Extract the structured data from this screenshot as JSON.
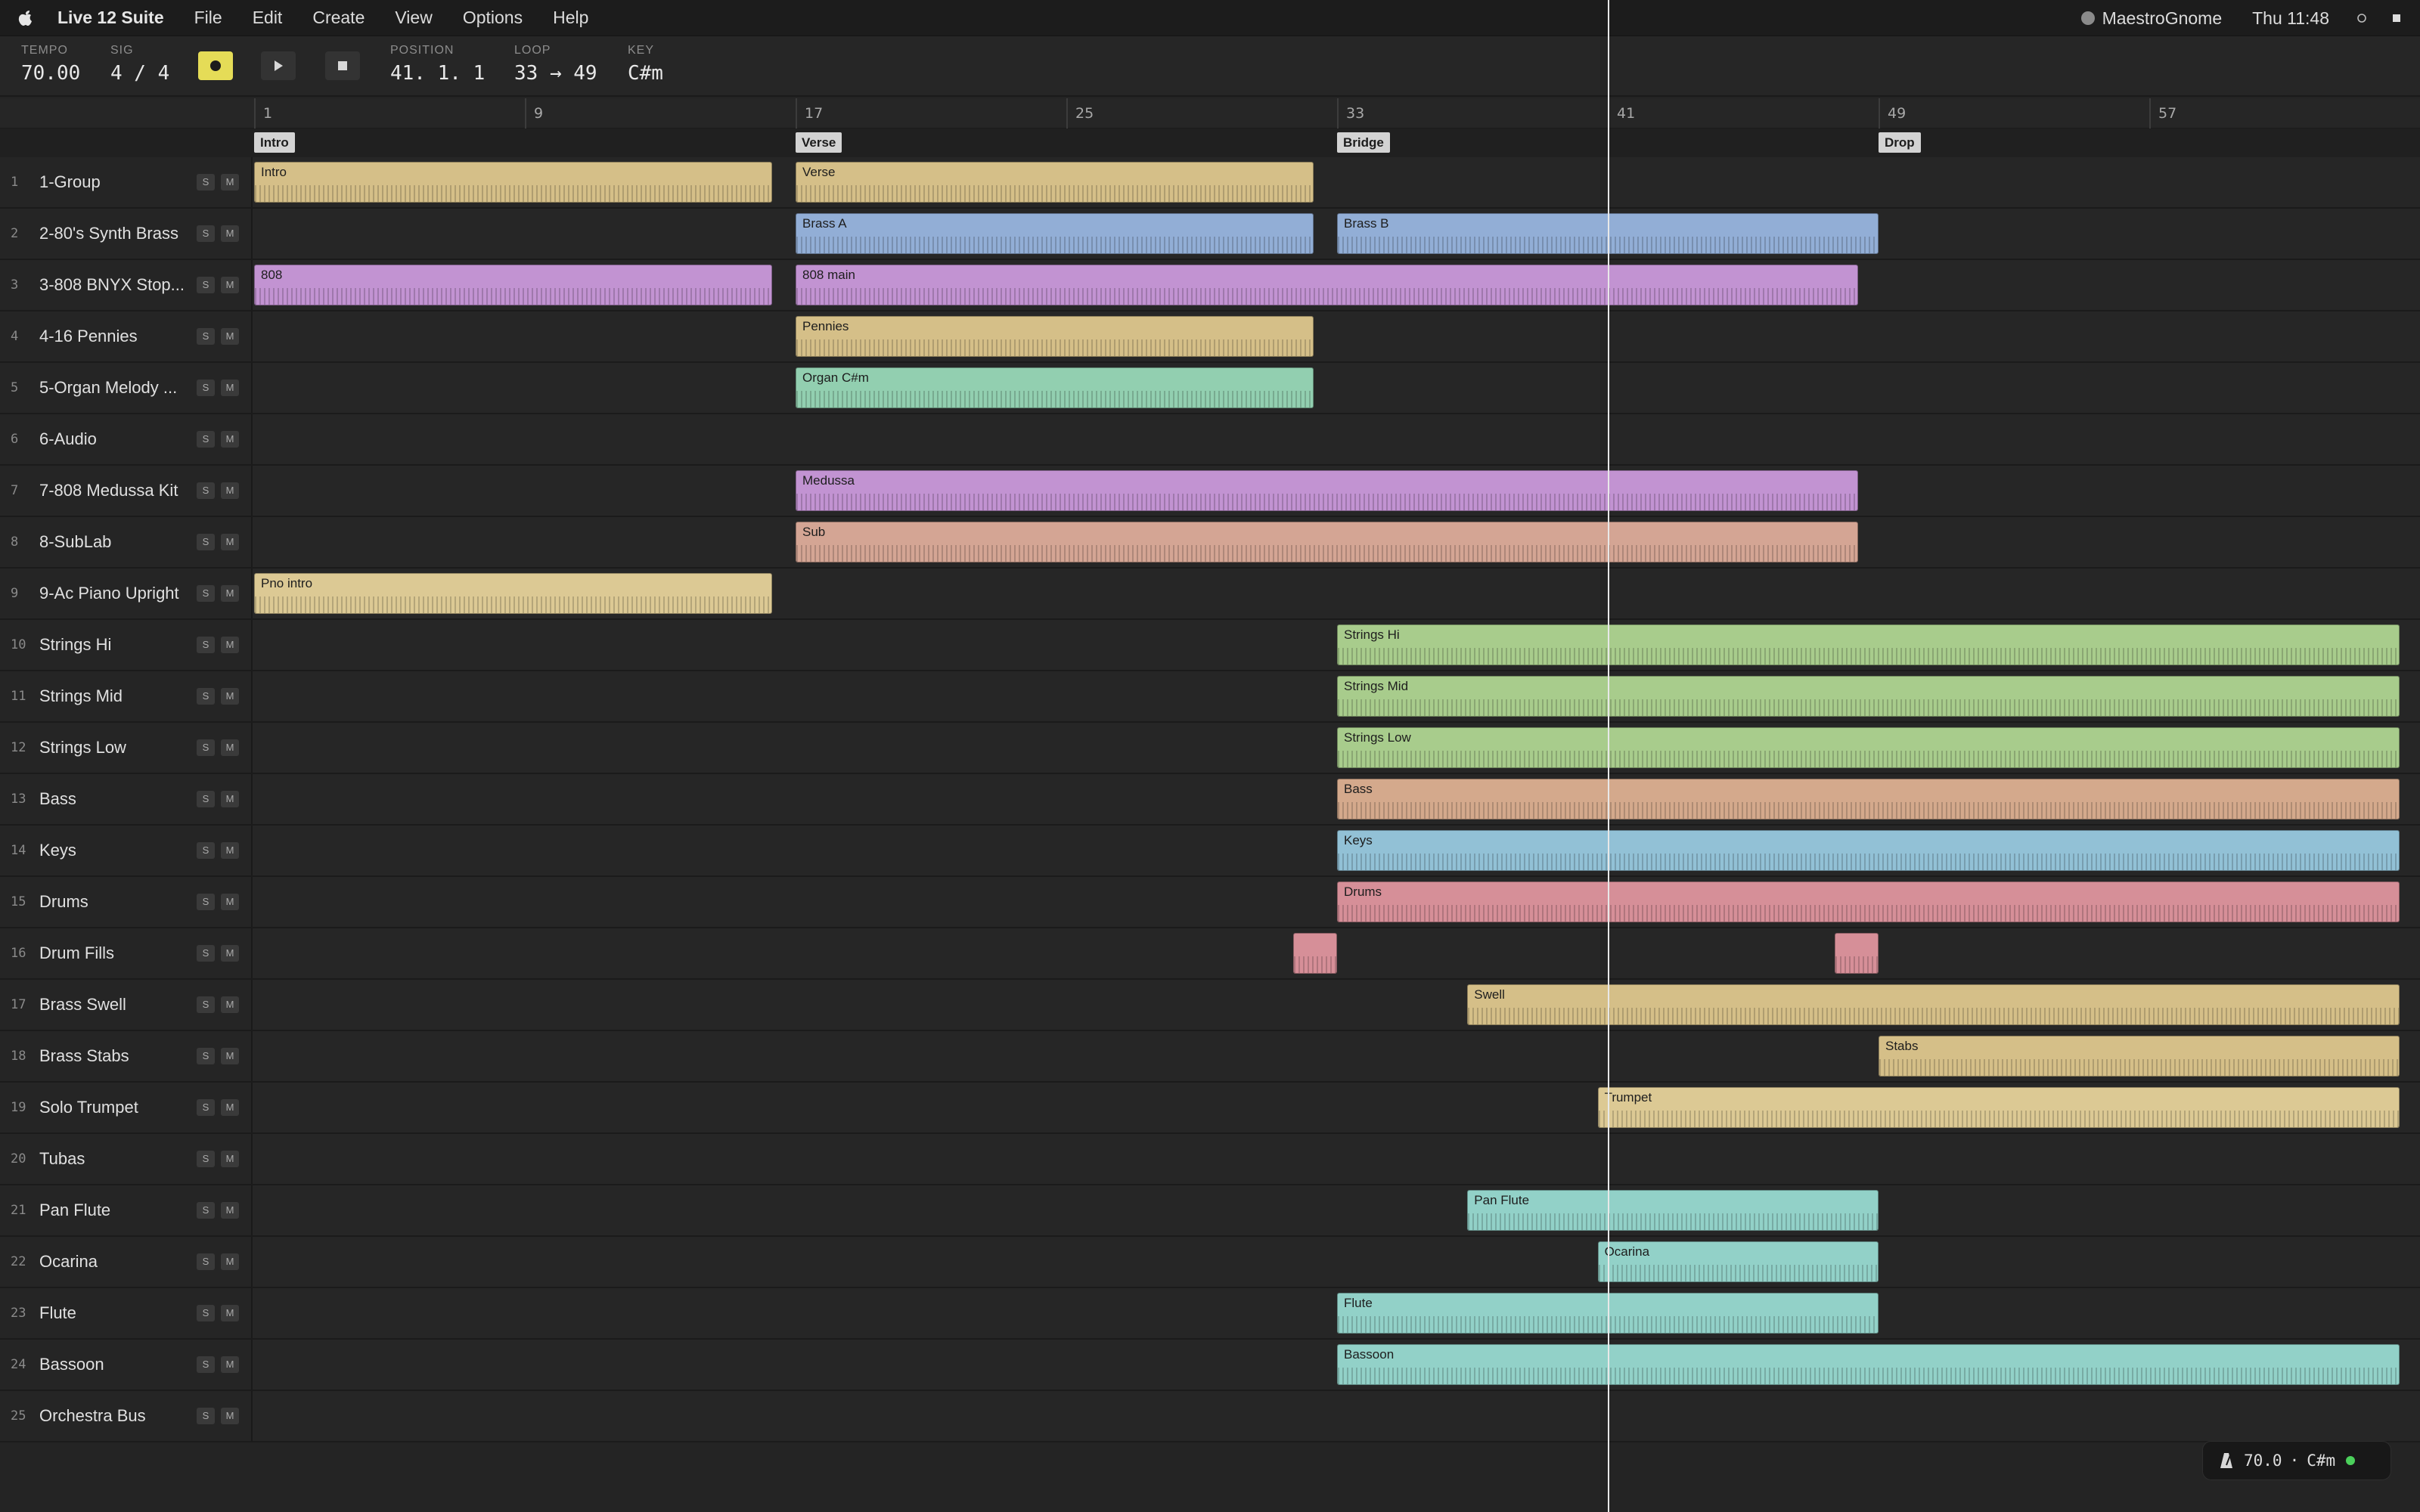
{
  "menubar": {
    "app_name": "Live 12 Suite",
    "menus": [
      "File",
      "Edit",
      "Create",
      "View",
      "Options",
      "Help"
    ],
    "user": "MaestroGnome",
    "clock": "Thu 11:48"
  },
  "transport": {
    "tempo_label": "TEMPO",
    "tempo": "70.00",
    "sig_label": "SIG",
    "sig": "4 / 4",
    "position_label": "POSITION",
    "position": "41. 1. 1",
    "loop_label": "LOOP",
    "loop": "33 → 49",
    "key_label": "KEY",
    "key": "C#m"
  },
  "ruler": [
    "1",
    "9",
    "17",
    "25",
    "33",
    "41",
    "49",
    "57"
  ],
  "locators": [
    {
      "label": "Intro",
      "bar": 1
    },
    {
      "label": "Verse",
      "bar": 17
    },
    {
      "label": "Bridge",
      "bar": 33
    },
    {
      "label": "Drop",
      "bar": 49
    }
  ],
  "playhead_bar": 41,
  "tracks": [
    {
      "num": "1",
      "name": "1-Group",
      "clips": [
        {
          "name": "Intro",
          "start": 1,
          "end": 16.3,
          "color": "#d5bf88"
        },
        {
          "name": "Verse",
          "start": 17,
          "end": 32.3,
          "color": "#d5bf88"
        }
      ]
    },
    {
      "num": "2",
      "name": "2-80's Synth Brass",
      "clips": [
        {
          "name": "Brass A",
          "start": 17,
          "end": 32.3,
          "color": "#92aed6"
        },
        {
          "name": "Brass B",
          "start": 33,
          "end": 49,
          "color": "#92aed6"
        }
      ]
    },
    {
      "num": "3",
      "name": "3-808 BNYX Stop...",
      "clips": [
        {
          "name": "808",
          "start": 1,
          "end": 16.3,
          "color": "#c293d2"
        },
        {
          "name": "808 main",
          "start": 17,
          "end": 48.4,
          "color": "#c293d2"
        }
      ]
    },
    {
      "num": "4",
      "name": "4-16 Pennies",
      "clips": [
        {
          "name": "Pennies",
          "start": 17,
          "end": 32.3,
          "color": "#d5bf88"
        }
      ]
    },
    {
      "num": "5",
      "name": "5-Organ Melody ...",
      "clips": [
        {
          "name": "Organ C#m",
          "start": 17,
          "end": 32.3,
          "color": "#92cfb0"
        }
      ]
    },
    {
      "num": "6",
      "name": "6-Audio",
      "clips": []
    },
    {
      "num": "7",
      "name": "7-808 Medussa Kit",
      "clips": [
        {
          "name": "Medussa",
          "start": 17,
          "end": 48.4,
          "color": "#c293d2"
        }
      ]
    },
    {
      "num": "8",
      "name": "8-SubLab",
      "clips": [
        {
          "name": "Sub",
          "start": 17,
          "end": 48.4,
          "color": "#d4a594"
        }
      ]
    },
    {
      "num": "9",
      "name": "9-Ac Piano Upright",
      "clips": [
        {
          "name": "Pno intro",
          "start": 1,
          "end": 16.3,
          "color": "#dcc994"
        }
      ]
    },
    {
      "num": "10",
      "name": "Strings Hi",
      "clips": [
        {
          "name": "Strings Hi",
          "start": 33,
          "end": 64.4,
          "color": "#a8cc8c"
        }
      ]
    },
    {
      "num": "11",
      "name": "Strings Mid",
      "clips": [
        {
          "name": "Strings Mid",
          "start": 33,
          "end": 64.4,
          "color": "#a8cc8c"
        }
      ]
    },
    {
      "num": "12",
      "name": "Strings Low",
      "clips": [
        {
          "name": "Strings Low",
          "start": 33,
          "end": 64.4,
          "color": "#a8cc8c"
        }
      ]
    },
    {
      "num": "13",
      "name": "Bass",
      "clips": [
        {
          "name": "Bass",
          "start": 33,
          "end": 64.4,
          "color": "#d4a98c"
        }
      ]
    },
    {
      "num": "14",
      "name": "Keys",
      "clips": [
        {
          "name": "Keys",
          "start": 33,
          "end": 64.4,
          "color": "#92c1d6"
        }
      ]
    },
    {
      "num": "15",
      "name": "Drums",
      "clips": [
        {
          "name": "Drums",
          "start": 33,
          "end": 64.4,
          "color": "#d68f98"
        }
      ]
    },
    {
      "num": "16",
      "name": "Drum Fills",
      "clips": [
        {
          "name": "",
          "start": 31.7,
          "end": 33,
          "color": "#d68f98"
        },
        {
          "name": "",
          "start": 47.7,
          "end": 49,
          "color": "#d68f98"
        }
      ]
    },
    {
      "num": "17",
      "name": "Brass Swell",
      "clips": [
        {
          "name": "Swell",
          "start": 36.85,
          "end": 64.4,
          "color": "#d5bf88"
        }
      ]
    },
    {
      "num": "18",
      "name": "Brass Stabs",
      "clips": [
        {
          "name": "Stabs",
          "start": 49,
          "end": 64.4,
          "color": "#d5bf88"
        }
      ]
    },
    {
      "num": "19",
      "name": "Solo Trumpet",
      "clips": [
        {
          "name": "Trumpet",
          "start": 40.7,
          "end": 64.4,
          "color": "#dcc994"
        }
      ]
    },
    {
      "num": "20",
      "name": "Tubas",
      "clips": []
    },
    {
      "num": "21",
      "name": "Pan Flute",
      "clips": [
        {
          "name": "Pan Flute",
          "start": 36.85,
          "end": 49,
          "color": "#92d1c8"
        }
      ]
    },
    {
      "num": "22",
      "name": "Ocarina",
      "clips": [
        {
          "name": "Ocarina",
          "start": 40.7,
          "end": 49,
          "color": "#92d1c8"
        }
      ]
    },
    {
      "num": "23",
      "name": "Flute",
      "clips": [
        {
          "name": "Flute",
          "start": 33,
          "end": 49,
          "color": "#92d1c8"
        }
      ]
    },
    {
      "num": "24",
      "name": "Bassoon",
      "clips": [
        {
          "name": "Bassoon",
          "start": 33,
          "end": 64.4,
          "color": "#92d1c8"
        }
      ]
    },
    {
      "num": "25",
      "name": "Orchestra Bus",
      "clips": []
    }
  ],
  "track_buttons": {
    "solo": "S",
    "mute": "M"
  },
  "status": {
    "tempo": "70.0",
    "sep": "·",
    "key": "C#m"
  }
}
